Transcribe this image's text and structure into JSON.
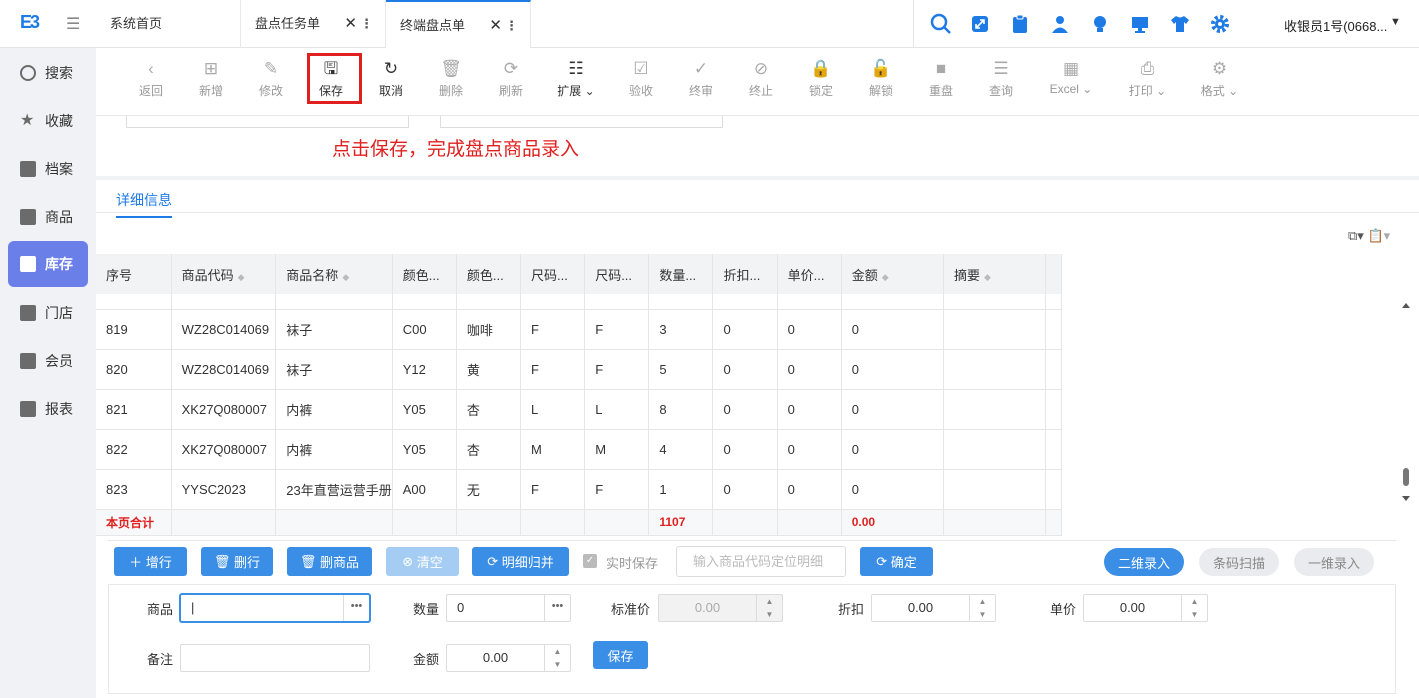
{
  "app": {
    "logo": "E3",
    "user": "收银员1号(0668..."
  },
  "tabs": [
    {
      "label": "系统首页"
    },
    {
      "label": "盘点任务单"
    },
    {
      "label": "终端盘点单"
    }
  ],
  "sidebar": {
    "items": [
      {
        "label": "搜索"
      },
      {
        "label": "收藏"
      },
      {
        "label": "档案"
      },
      {
        "label": "商品"
      },
      {
        "label": "库存"
      },
      {
        "label": "门店"
      },
      {
        "label": "会员"
      },
      {
        "label": "报表"
      }
    ],
    "active": "库存"
  },
  "toolbar": {
    "items": [
      {
        "label": "返回",
        "icon": "back-icon",
        "enabled": false
      },
      {
        "label": "新增",
        "icon": "add-icon",
        "enabled": false
      },
      {
        "label": "修改",
        "icon": "edit-icon",
        "enabled": false
      },
      {
        "label": "保存",
        "icon": "save-icon",
        "enabled": true
      },
      {
        "label": "取消",
        "icon": "undo-icon",
        "enabled": true
      },
      {
        "label": "删除",
        "icon": "trash-icon",
        "enabled": false
      },
      {
        "label": "刷新",
        "icon": "refresh-icon",
        "enabled": false
      },
      {
        "label": "扩展",
        "icon": "extend-icon",
        "enabled": true
      },
      {
        "label": "验收",
        "icon": "check-icon",
        "enabled": false
      },
      {
        "label": "终审",
        "icon": "approve-icon",
        "enabled": false
      },
      {
        "label": "终止",
        "icon": "stop-icon",
        "enabled": false
      },
      {
        "label": "锁定",
        "icon": "lock-icon",
        "enabled": false
      },
      {
        "label": "解锁",
        "icon": "unlock-icon",
        "enabled": false
      },
      {
        "label": "重盘",
        "icon": "recount-icon",
        "enabled": false
      },
      {
        "label": "查询",
        "icon": "query-icon",
        "enabled": false
      },
      {
        "label": "Excel",
        "icon": "excel-icon",
        "enabled": false
      },
      {
        "label": "打印",
        "icon": "print-icon",
        "enabled": false
      },
      {
        "label": "格式",
        "icon": "format-icon",
        "enabled": false
      }
    ]
  },
  "annotation": "点击保存，完成盘点商品录入",
  "detail": {
    "tab": "详细信息"
  },
  "grid": {
    "columns": [
      "序号",
      "商品代码",
      "商品名称",
      "颜色...",
      "颜色...",
      "尺码...",
      "尺码...",
      "数量...",
      "折扣...",
      "单价...",
      "金额",
      "摘要"
    ],
    "rows": [
      [
        "819",
        "WZ28C014069",
        "袜子",
        "C00",
        "咖啡",
        "F",
        "F",
        "3",
        "0",
        "0",
        "0",
        ""
      ],
      [
        "820",
        "WZ28C014069",
        "袜子",
        "Y12",
        "黄",
        "F",
        "F",
        "5",
        "0",
        "0",
        "0",
        ""
      ],
      [
        "821",
        "XK27Q080007",
        "内裤",
        "Y05",
        "杏",
        "L",
        "L",
        "8",
        "0",
        "0",
        "0",
        ""
      ],
      [
        "822",
        "XK27Q080007",
        "内裤",
        "Y05",
        "杏",
        "M",
        "M",
        "4",
        "0",
        "0",
        "0",
        ""
      ],
      [
        "823",
        "YYSC2023",
        "23年直营运营手册",
        "A00",
        "无",
        "F",
        "F",
        "1",
        "0",
        "0",
        "0",
        ""
      ]
    ],
    "total": {
      "label": "本页合计",
      "qty": "1107",
      "amount": "0.00"
    }
  },
  "actions": {
    "add_row": "增行",
    "del_row": "删行",
    "del_goods": "删商品",
    "clear": "清空",
    "merge": "明细归并",
    "realtime": "实时保存",
    "locate_placeholder": "输入商品代码定位明细",
    "confirm": "确定",
    "qr": "二维录入",
    "barcode": "条码扫描",
    "oned": "一维录入"
  },
  "entry": {
    "goods_label": "商品",
    "goods_value": "",
    "qty_label": "数量",
    "qty_value": "0",
    "std_price_label": "标准价",
    "std_price_value": "0.00",
    "discount_label": "折扣",
    "discount_value": "0.00",
    "price_label": "单价",
    "price_value": "0.00",
    "remark_label": "备注",
    "remark_value": "",
    "amount_label": "金额",
    "amount_value": "0.00",
    "save": "保存"
  },
  "colors": {
    "accent": "#1e7be6",
    "active_nav": "#6b7fe8",
    "highlight": "#e0201f"
  }
}
